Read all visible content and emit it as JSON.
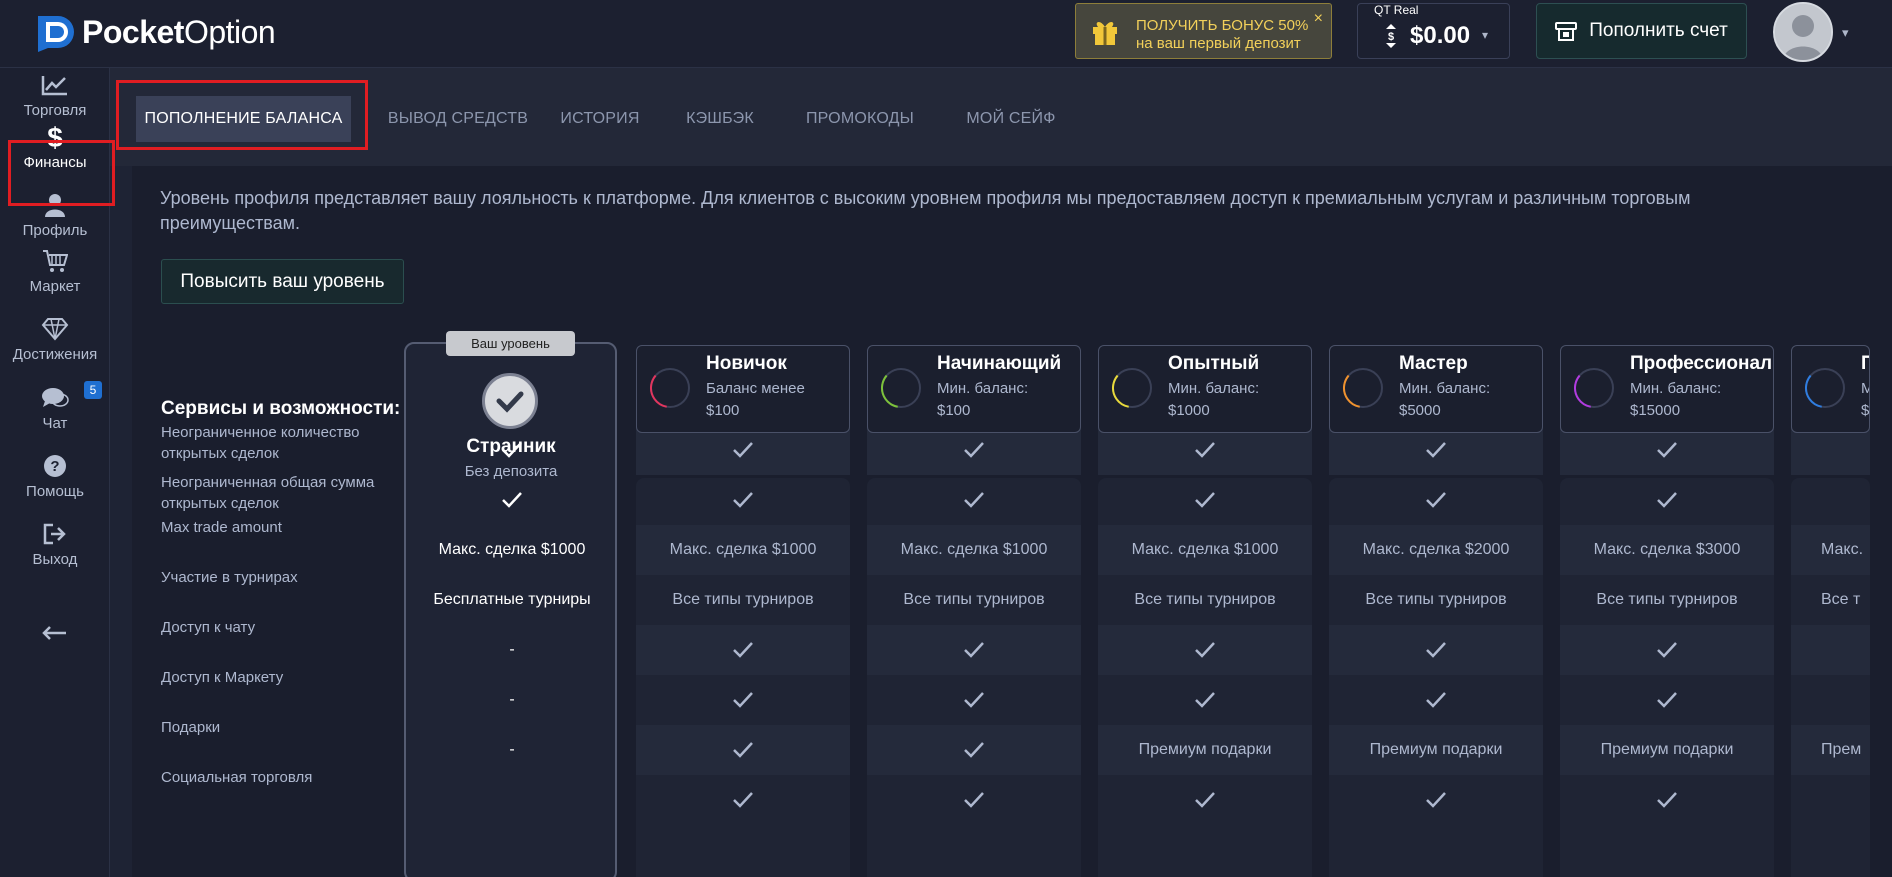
{
  "header": {
    "logo_bold": "Pocket",
    "logo_light": "Option",
    "bonus": {
      "line1": "ПОЛУЧИТЬ БОНУС 50%",
      "line2": "на ваш первый депозит",
      "close": "×"
    },
    "account": {
      "type": "QT Real",
      "balance": "$0.00",
      "chevron": "▾"
    },
    "deposit_label": "Пополнить счет",
    "avatar_chevron": "▾"
  },
  "sidebar": {
    "items": [
      {
        "label": "Торговля",
        "icon": "chart-line-icon"
      },
      {
        "label": "Финансы",
        "icon": "dollar-icon"
      },
      {
        "label": "Профиль",
        "icon": "user-icon"
      },
      {
        "label": "Маркет",
        "icon": "cart-icon"
      },
      {
        "label": "Достижения",
        "icon": "diamond-icon"
      },
      {
        "label": "Чат",
        "icon": "chat-icon",
        "badge": "5"
      },
      {
        "label": "Помощь",
        "icon": "help-icon"
      },
      {
        "label": "Выход",
        "icon": "logout-icon"
      }
    ],
    "collapse": "←"
  },
  "tabs": [
    "ПОПОЛНЕНИЕ БАЛАНСА",
    "ВЫВОД СРЕДСТВ",
    "ИСТОРИЯ",
    "КЭШБЭК",
    "ПРОМОКОДЫ",
    "МОЙ СЕЙФ"
  ],
  "intro": "Уровень профиля представляет вашу лояльность к платформе. Для клиентов с высоким уровнем профиля мы предоставляем доступ к премиальным услугам и различным торговым преимуществам.",
  "raise_button": "Повысить ваш уровень",
  "services_title": "Сервисы и возможности:",
  "row_labels": [
    "Неограниченное количество открытых сделок",
    "Неограниченная общая сумма открытых сделок",
    "Max trade amount",
    "Участие в турнирах",
    "Доступ к чату",
    "Доступ к Маркету",
    "Подарки",
    "Социальная торговля"
  ],
  "current_level": {
    "badge": "Ваш уровень",
    "name": "Странник",
    "subtitle": "Без депозита",
    "cells": [
      "check",
      "check",
      "Макс. сделка $1000",
      "Бесплатные турниры",
      "-",
      "-",
      "-"
    ]
  },
  "levels": [
    {
      "name": "Новичок",
      "sub1": "Баланс менее",
      "sub2": "$100",
      "ring_color": "#e2355e",
      "cells": [
        "check",
        "check",
        "Макс. сделка $1000",
        "Все типы турниров",
        "check",
        "check",
        "check",
        "check"
      ]
    },
    {
      "name": "Начинающий",
      "sub1": "Мин. баланс:",
      "sub2": "$100",
      "ring_color": "#7dc23b",
      "cells": [
        "check",
        "check",
        "Макс. сделка $1000",
        "Все типы турниров",
        "check",
        "check",
        "check",
        "check"
      ]
    },
    {
      "name": "Опытный",
      "sub1": "Мин. баланс:",
      "sub2": "$1000",
      "ring_color": "#e8d93b",
      "cells": [
        "check",
        "check",
        "Макс. сделка $1000",
        "Все типы турниров",
        "check",
        "check",
        "Премиум подарки",
        "check"
      ]
    },
    {
      "name": "Мастер",
      "sub1": "Мин. баланс:",
      "sub2": "$5000",
      "ring_color": "#f0922e",
      "cells": [
        "check",
        "check",
        "Макс. сделка $2000",
        "Все типы турниров",
        "check",
        "check",
        "Премиум подарки",
        "check"
      ]
    },
    {
      "name": "Профессионал",
      "sub1": "Мин. баланс:",
      "sub2": "$15000",
      "ring_color": "#b23be0",
      "cells": [
        "check",
        "check",
        "Макс. сделка $3000",
        "Все типы турниров",
        "check",
        "check",
        "Премиум подарки",
        "check"
      ]
    },
    {
      "name": "П",
      "sub1": "М",
      "sub2": "$",
      "ring_color": "#2f7de0",
      "cells": [
        "",
        "",
        "Макс.",
        "Все т",
        "",
        "",
        "Прем",
        ""
      ]
    }
  ]
}
